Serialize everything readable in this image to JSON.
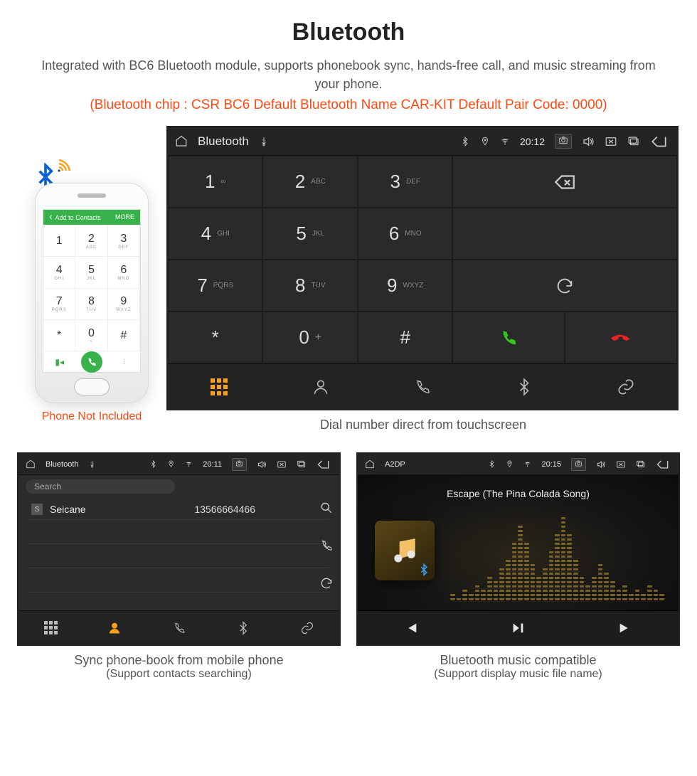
{
  "title": "Bluetooth",
  "description": "Integrated with BC6 Bluetooth module, supports phonebook sync, hands-free call, and music streaming from your phone.",
  "specs": "(Bluetooth chip : CSR BC6    Default Bluetooth Name CAR-KIT    Default Pair Code: 0000)",
  "phone": {
    "header_left": "Add to Contacts",
    "header_right": "MORE",
    "not_included": "Phone Not Included",
    "keys": [
      {
        "d": "1",
        "l": ""
      },
      {
        "d": "2",
        "l": "ABC"
      },
      {
        "d": "3",
        "l": "DEF"
      },
      {
        "d": "4",
        "l": "GHI"
      },
      {
        "d": "5",
        "l": "JKL"
      },
      {
        "d": "6",
        "l": "MNO"
      },
      {
        "d": "7",
        "l": "PQRS"
      },
      {
        "d": "8",
        "l": "TUV"
      },
      {
        "d": "9",
        "l": "WXYZ"
      },
      {
        "d": "*",
        "l": ""
      },
      {
        "d": "0",
        "l": "+"
      },
      {
        "d": "#",
        "l": ""
      }
    ]
  },
  "dialer": {
    "app_name": "Bluetooth",
    "time": "20:12",
    "caption": "Dial number direct from touchscreen",
    "keys": [
      {
        "d": "1",
        "l": "∞"
      },
      {
        "d": "2",
        "l": "ABC"
      },
      {
        "d": "3",
        "l": "DEF"
      },
      {
        "d": "4",
        "l": "GHI"
      },
      {
        "d": "5",
        "l": "JKL"
      },
      {
        "d": "6",
        "l": "MNO"
      },
      {
        "d": "7",
        "l": "PQRS"
      },
      {
        "d": "8",
        "l": "TUV"
      },
      {
        "d": "9",
        "l": "WXYZ"
      },
      {
        "d": "*",
        "l": ""
      },
      {
        "d": "0",
        "l": "+"
      },
      {
        "d": "#",
        "l": ""
      }
    ]
  },
  "contacts": {
    "app_name": "Bluetooth",
    "time": "20:11",
    "search_placeholder": "Search",
    "rows": [
      {
        "tag": "S",
        "name": "Seicane",
        "number": "13566664466"
      }
    ],
    "caption": "Sync phone-book from mobile phone",
    "caption_sub": "(Support contacts searching)"
  },
  "music": {
    "app_name": "A2DP",
    "time": "20:15",
    "track": "Escape (The Pina Colada Song)",
    "caption": "Bluetooth music compatible",
    "caption_sub": "(Support display music file name)"
  }
}
